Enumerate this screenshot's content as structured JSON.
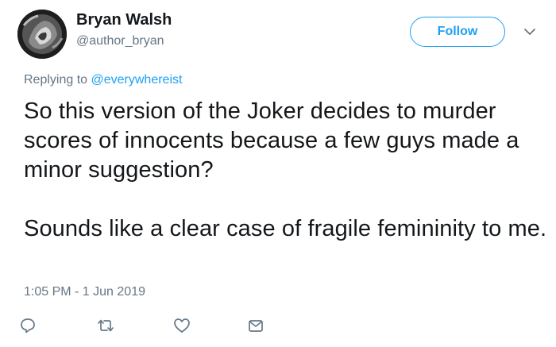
{
  "author": {
    "name": "Bryan Walsh",
    "handle": "@author_bryan",
    "avatar_icon": "avatar-photo"
  },
  "follow_label": "Follow",
  "reply_context": {
    "prefix": "Replying to ",
    "mention": "@everywhereist"
  },
  "tweet": {
    "paragraph_1": "So this version of the Joker decides to murder scores of innocents because a few guys made a minor suggestion?",
    "paragraph_2": "Sounds like a clear case of fragile femininity to me.",
    "timestamp": "1:05 PM - 1 Jun 2019"
  },
  "actions": {
    "icons": [
      "reply-icon",
      "retweet-icon",
      "like-icon",
      "message-icon"
    ]
  },
  "colors": {
    "accent": "#1da1f2",
    "muted": "#657786",
    "text": "#14171a"
  }
}
